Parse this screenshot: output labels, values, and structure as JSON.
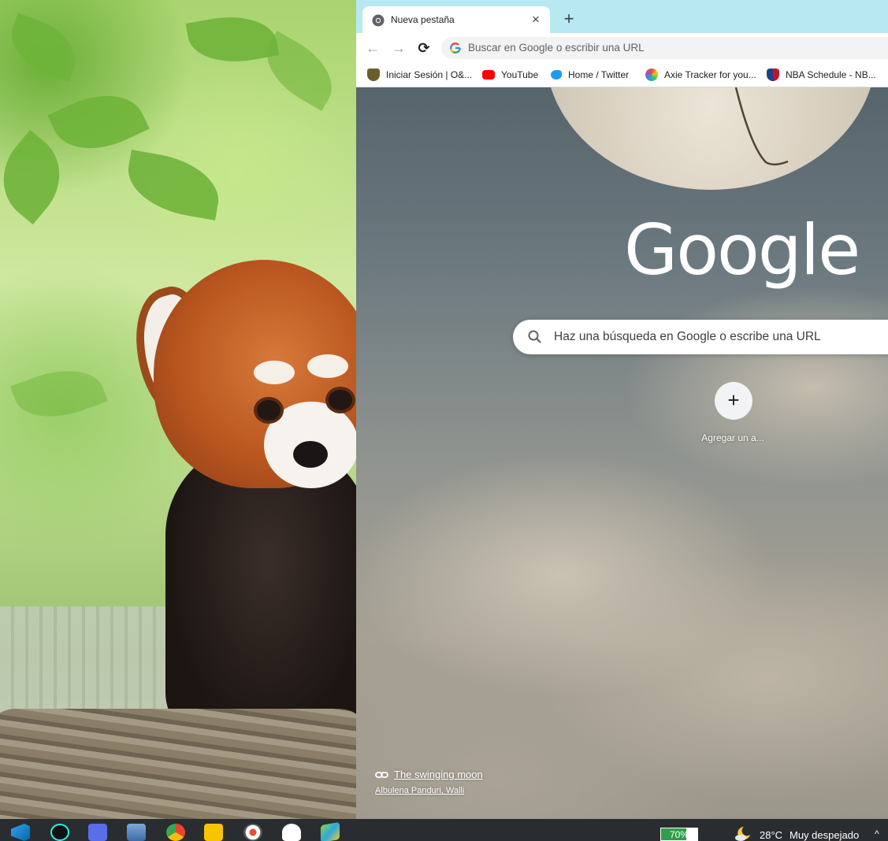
{
  "browser": {
    "tab": {
      "title": "Nueva pestaña",
      "close_glyph": "×",
      "favicon": "chrome-icon"
    },
    "new_tab_glyph": "+",
    "nav": {
      "back_glyph": "←",
      "forward_glyph": "→",
      "reload_glyph": "⟳"
    },
    "omnibox": {
      "placeholder": "Buscar en Google o escribir una URL",
      "icon": "google-g-icon"
    },
    "bookmarks": [
      {
        "label": "Iniciar Sesión | O&...",
        "icon": "shield-icon"
      },
      {
        "label": "YouTube",
        "icon": "youtube-icon"
      },
      {
        "label": "Home / Twitter",
        "icon": "twitter-icon"
      },
      {
        "label": "Axie Tracker for you...",
        "icon": "axie-icon"
      },
      {
        "label": "NBA Schedule - NB...",
        "icon": "nba-icon"
      }
    ]
  },
  "ntp": {
    "logo": "Google",
    "search_placeholder": "Haz una búsqueda en Google o escribe una URL",
    "shortcut_add_glyph": "+",
    "shortcut_add_label": "Agregar un a...",
    "background_title": "The swinging moon",
    "background_author": "Albulena Panduri, Walli"
  },
  "taskbar": {
    "apps": [
      "vscode-icon",
      "tiktok-icon",
      "opgg-icon",
      "news-icon",
      "chrome-icon",
      "sticky-notes-icon",
      "music-icon",
      "ghost-icon",
      "bluestacks-icon"
    ],
    "battery": {
      "text": "70%",
      "level": 0.7
    },
    "weather": {
      "temp": "28°C",
      "description": "Muy despejado",
      "icon": "moon-cloud-icon"
    },
    "tray_chevron": "^"
  },
  "colors": {
    "tab_strip": "#b8e8f1",
    "battery_green": "#2e9e4a",
    "taskbar": "#2a2d30"
  }
}
